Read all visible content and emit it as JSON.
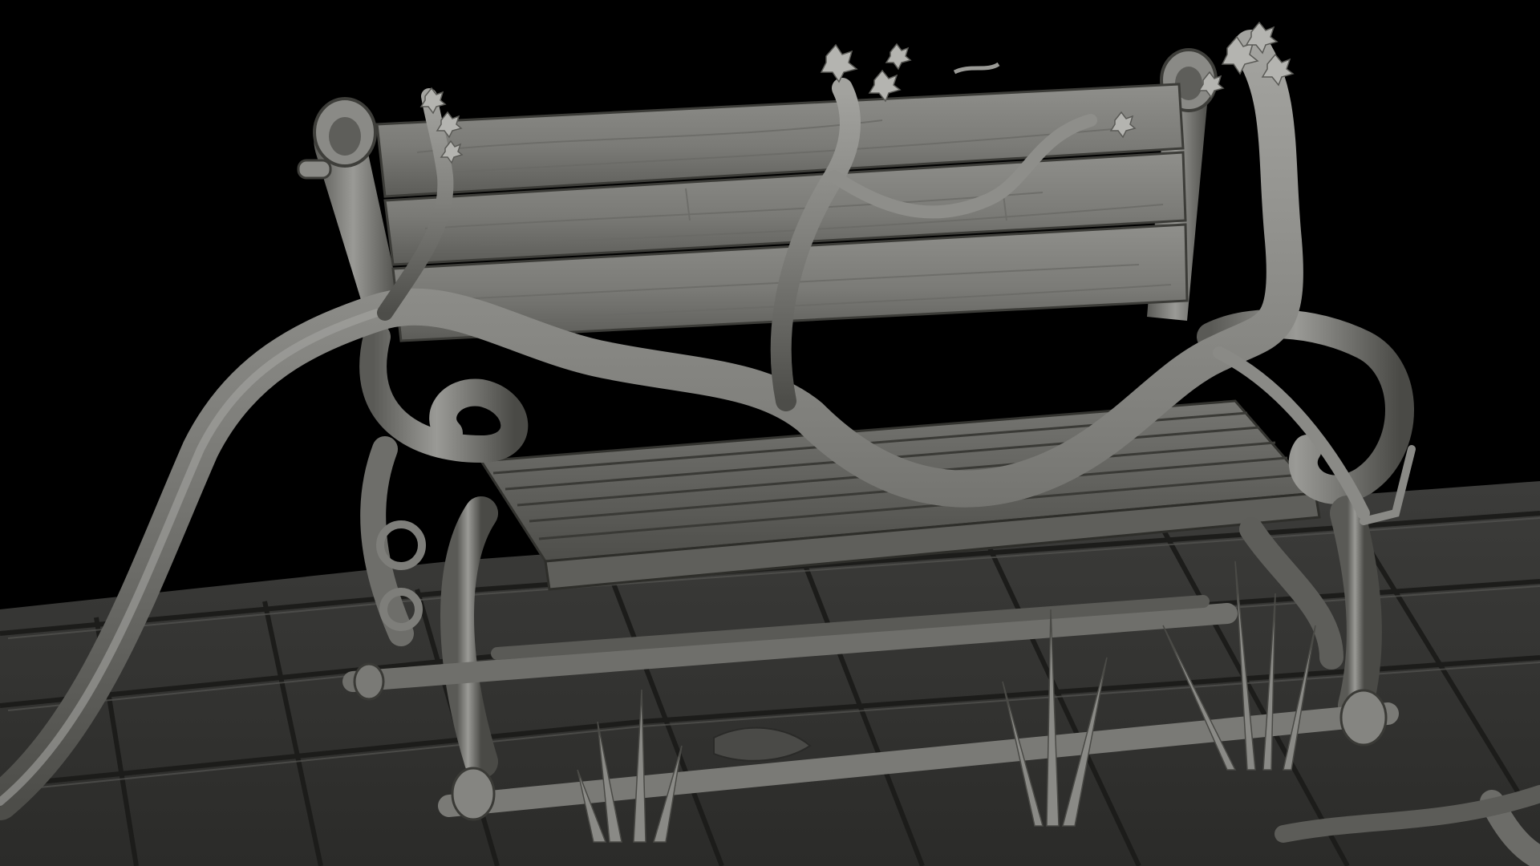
{
  "scene": {
    "subject": "bench-with-vines",
    "palette": {
      "background": "#000000",
      "clay_light": "#9a9a96",
      "clay_mid": "#7d7d79",
      "clay_dark": "#55554f",
      "clay_shadow": "#2c2c29",
      "ground_light": "#4a4a47",
      "ground_dark": "#2a2a28",
      "seam": "#1c1c1a"
    }
  }
}
